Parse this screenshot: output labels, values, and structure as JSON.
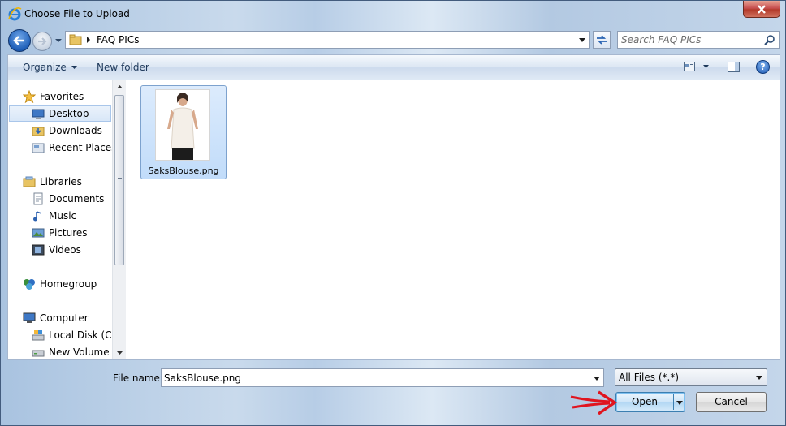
{
  "window": {
    "title": "Choose File to Upload"
  },
  "address": {
    "path_label": "FAQ PICs"
  },
  "search": {
    "placeholder": "Search FAQ PICs"
  },
  "toolbar": {
    "organize_label": "Organize",
    "new_folder_label": "New folder",
    "help_label": "?"
  },
  "sidebar": {
    "items": [
      {
        "label": "Favorites",
        "icon": "star-icon"
      },
      {
        "label": "Desktop",
        "icon": "desktop-icon",
        "selected": true
      },
      {
        "label": "Downloads",
        "icon": "downloads-folder-icon"
      },
      {
        "label": "Recent Places",
        "icon": "recent-places-icon"
      },
      {
        "label": "Libraries",
        "icon": "libraries-icon"
      },
      {
        "label": "Documents",
        "icon": "documents-icon"
      },
      {
        "label": "Music",
        "icon": "music-icon"
      },
      {
        "label": "Pictures",
        "icon": "pictures-icon"
      },
      {
        "label": "Videos",
        "icon": "videos-icon"
      },
      {
        "label": "Homegroup",
        "icon": "homegroup-icon"
      },
      {
        "label": "Computer",
        "icon": "computer-icon"
      },
      {
        "label": "Local Disk (C:)",
        "icon": "local-disk-icon"
      },
      {
        "label": "New Volume (E",
        "icon": "volume-drive-icon"
      }
    ]
  },
  "files": [
    {
      "name": "SaksBlouse.png",
      "selected": true
    }
  ],
  "footer": {
    "file_name_label": "File name:",
    "file_name_value": "SaksBlouse.png",
    "file_type_value": "All Files (*.*)",
    "open_label": "Open",
    "cancel_label": "Cancel"
  },
  "colors": {
    "accent": "#3c7fb1",
    "annotation_arrow": "#e0141e"
  }
}
